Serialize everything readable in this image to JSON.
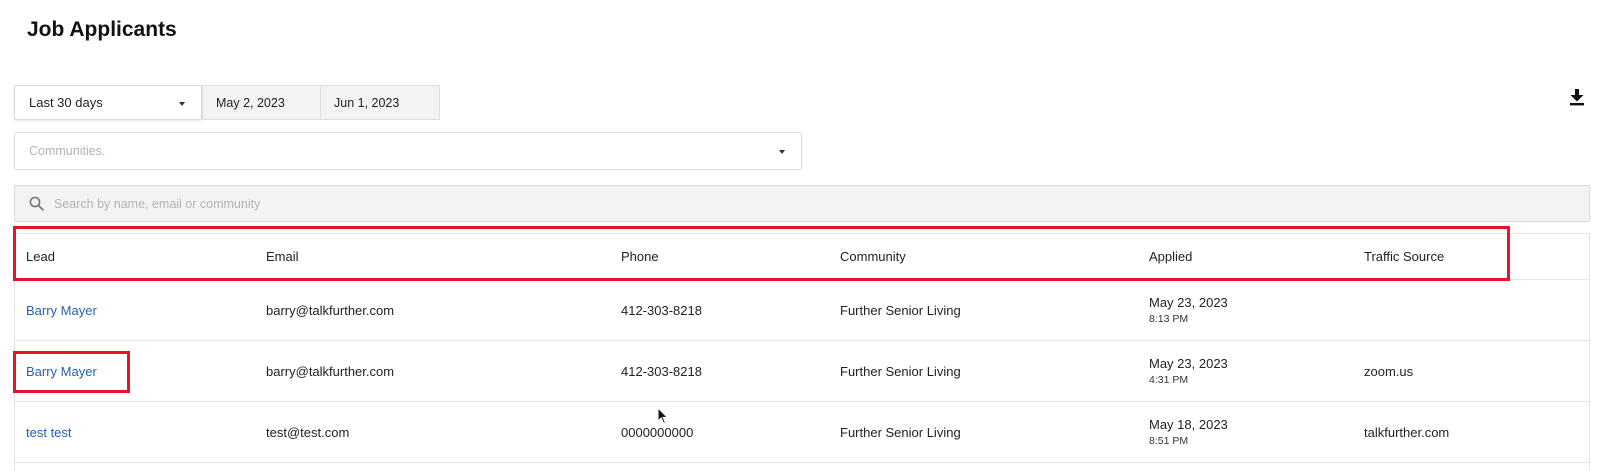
{
  "page": {
    "title": "Job Applicants"
  },
  "filters": {
    "range_label": "Last 30 days",
    "start_date": "May 2, 2023",
    "end_date": "Jun 1, 2023",
    "communities_placeholder": "Communities."
  },
  "search": {
    "placeholder": "Search by name, email or community",
    "value": ""
  },
  "table": {
    "columns": [
      "Lead",
      "Email",
      "Phone",
      "Community",
      "Applied",
      "Traffic Source"
    ],
    "rows": [
      {
        "lead": "Barry Mayer",
        "email": "barry@talkfurther.com",
        "phone": "412-303-8218",
        "community": "Further Senior Living",
        "applied_date": "May 23, 2023",
        "applied_time": "8:13 PM",
        "traffic_source": ""
      },
      {
        "lead": "Barry Mayer",
        "email": "barry@talkfurther.com",
        "phone": "412-303-8218",
        "community": "Further Senior Living",
        "applied_date": "May 23, 2023",
        "applied_time": "4:31 PM",
        "traffic_source": "zoom.us"
      },
      {
        "lead": "test test",
        "email": "test@test.com",
        "phone": "0000000000",
        "community": "Further Senior Living",
        "applied_date": "May 18, 2023",
        "applied_time": "8:51 PM",
        "traffic_source": "talkfurther.com"
      }
    ]
  },
  "icons": {
    "download": "download-icon",
    "search": "search-icon",
    "dropdown": "chevron-down-icon",
    "cursor": "mouse-pointer-icon"
  },
  "colors": {
    "link": "#2462ad",
    "highlight": "#e8132a",
    "input_bg": "#f3f3f5"
  }
}
